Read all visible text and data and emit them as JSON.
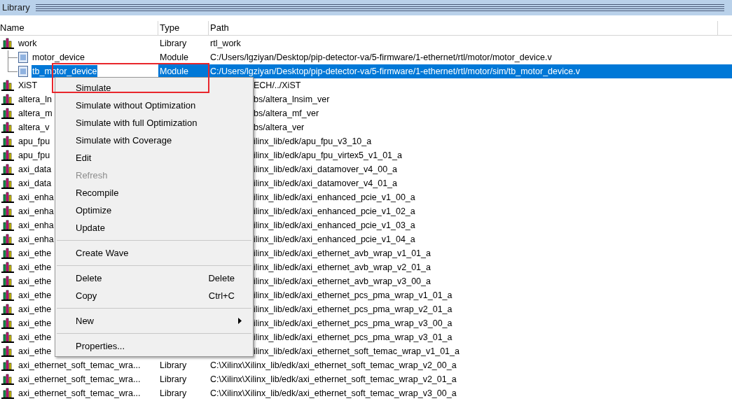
{
  "panel": {
    "title": "Library"
  },
  "columns": [
    "Name",
    "Type",
    "Path"
  ],
  "rows": [
    {
      "name": "work",
      "kind": "library",
      "type": "Library",
      "path": "rtl_work",
      "selected": false,
      "children": [
        {
          "name": "motor_device",
          "kind": "module",
          "type": "Module",
          "path": "C:/Users/lgziyan/Desktop/pip-detector-va/5-firmware/1-ethernet/rtl/motor/motor_device.v",
          "selected": false
        },
        {
          "name": "tb_motor_device",
          "kind": "module",
          "type": "Module",
          "path": "C:/Users/lgziyan/Desktop/pip-detector-va/5-firmware/1-ethernet/rtl/motor/sim/tb_motor_device.v",
          "selected": true
        }
      ]
    },
    {
      "name": "XiST",
      "kind": "library",
      "path": "ECH/../XiST",
      "selected": false
    },
    {
      "name": "altera_ln",
      "kind": "library",
      "path": "bs/altera_lnsim_ver",
      "selected": false
    },
    {
      "name": "altera_m",
      "kind": "library",
      "path": "bs/altera_mf_ver",
      "selected": false
    },
    {
      "name": "altera_v",
      "kind": "library",
      "path": "bs/altera_ver",
      "selected": false
    },
    {
      "name": "apu_fpu",
      "kind": "library",
      "path": "ilinx_lib/edk/apu_fpu_v3_10_a",
      "selected": false
    },
    {
      "name": "apu_fpu",
      "kind": "library",
      "path": "ilinx_lib/edk/apu_fpu_virtex5_v1_01_a",
      "selected": false
    },
    {
      "name": "axi_data",
      "kind": "library",
      "path": "ilinx_lib/edk/axi_datamover_v4_00_a",
      "selected": false
    },
    {
      "name": "axi_data",
      "kind": "library",
      "path": "ilinx_lib/edk/axi_datamover_v4_01_a",
      "selected": false
    },
    {
      "name": "axi_enha",
      "kind": "library",
      "path": "ilinx_lib/edk/axi_enhanced_pcie_v1_00_a",
      "selected": false
    },
    {
      "name": "axi_enha",
      "kind": "library",
      "path": "ilinx_lib/edk/axi_enhanced_pcie_v1_02_a",
      "selected": false
    },
    {
      "name": "axi_enha",
      "kind": "library",
      "path": "ilinx_lib/edk/axi_enhanced_pcie_v1_03_a",
      "selected": false
    },
    {
      "name": "axi_enha",
      "kind": "library",
      "path": "ilinx_lib/edk/axi_enhanced_pcie_v1_04_a",
      "selected": false
    },
    {
      "name": "axi_ethe",
      "kind": "library",
      "path": "ilinx_lib/edk/axi_ethernet_avb_wrap_v1_01_a",
      "selected": false
    },
    {
      "name": "axi_ethe",
      "kind": "library",
      "path": "ilinx_lib/edk/axi_ethernet_avb_wrap_v2_01_a",
      "selected": false
    },
    {
      "name": "axi_ethe",
      "kind": "library",
      "path": "ilinx_lib/edk/axi_ethernet_avb_wrap_v3_00_a",
      "selected": false
    },
    {
      "name": "axi_ethe",
      "kind": "library",
      "path": "ilinx_lib/edk/axi_ethernet_pcs_pma_wrap_v1_01_a",
      "selected": false
    },
    {
      "name": "axi_ethe",
      "kind": "library",
      "path": "ilinx_lib/edk/axi_ethernet_pcs_pma_wrap_v2_01_a",
      "selected": false
    },
    {
      "name": "axi_ethe",
      "kind": "library",
      "path": "ilinx_lib/edk/axi_ethernet_pcs_pma_wrap_v3_00_a",
      "selected": false
    },
    {
      "name": "axi_ethe",
      "kind": "library",
      "path": "ilinx_lib/edk/axi_ethernet_pcs_pma_wrap_v3_01_a",
      "selected": false
    },
    {
      "name": "axi_ethe",
      "kind": "library",
      "path": "ilinx_lib/edk/axi_ethernet_soft_temac_wrap_v1_01_a",
      "selected": false
    },
    {
      "name": "axi_ethernet_soft_temac_wra...",
      "kind": "library",
      "type": "Library",
      "path": "C:\\Xilinx\\Xilinx_lib/edk/axi_ethernet_soft_temac_wrap_v2_00_a",
      "selected": false
    },
    {
      "name": "axi_ethernet_soft_temac_wra...",
      "kind": "library",
      "type": "Library",
      "path": "C:\\Xilinx\\Xilinx_lib/edk/axi_ethernet_soft_temac_wrap_v2_01_a",
      "selected": false
    },
    {
      "name": "axi_ethernet_soft_temac_wra...",
      "kind": "library",
      "type": "Library",
      "path": "C:\\Xilinx\\Xilinx_lib/edk/axi_ethernet_soft_temac_wrap_v3_00_a",
      "selected": false
    }
  ],
  "context_menu": {
    "items": [
      {
        "kind": "item",
        "label": "Simulate",
        "disabled": false
      },
      {
        "kind": "item",
        "label": "Simulate without Optimization",
        "disabled": false
      },
      {
        "kind": "item",
        "label": "Simulate with full Optimization",
        "disabled": false
      },
      {
        "kind": "item",
        "label": "Simulate with Coverage",
        "disabled": false
      },
      {
        "kind": "item",
        "label": "Edit",
        "disabled": false
      },
      {
        "kind": "item",
        "label": "Refresh",
        "disabled": true
      },
      {
        "kind": "item",
        "label": "Recompile",
        "disabled": false
      },
      {
        "kind": "item",
        "label": "Optimize",
        "disabled": false
      },
      {
        "kind": "item",
        "label": "Update",
        "disabled": false
      },
      {
        "kind": "separator"
      },
      {
        "kind": "item",
        "label": "Create Wave",
        "disabled": false
      },
      {
        "kind": "separator"
      },
      {
        "kind": "item",
        "label": "Delete",
        "shortcut": "Delete",
        "disabled": false
      },
      {
        "kind": "item",
        "label": "Copy",
        "shortcut": "Ctrl+C",
        "disabled": false
      },
      {
        "kind": "separator"
      },
      {
        "kind": "item",
        "label": "New",
        "submenu": true,
        "disabled": false
      },
      {
        "kind": "separator"
      },
      {
        "kind": "item",
        "label": "Properties...",
        "disabled": false
      }
    ]
  }
}
